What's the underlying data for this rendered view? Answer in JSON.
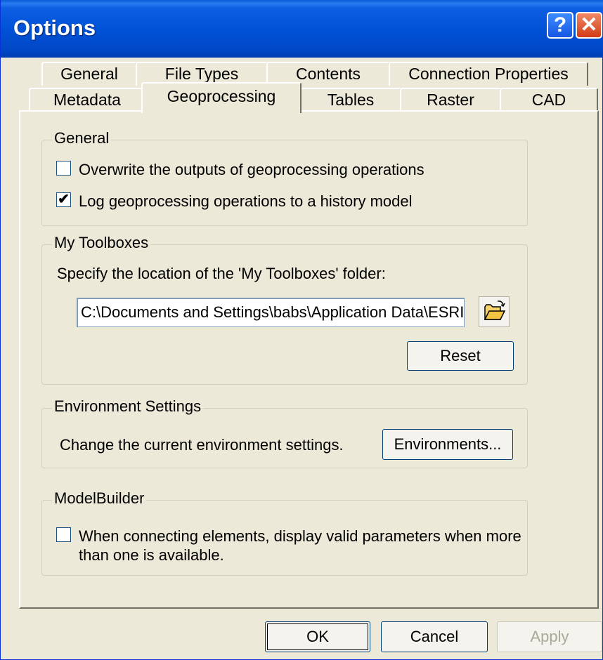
{
  "window": {
    "title": "Options",
    "help_glyph": "?",
    "close_glyph": "✕"
  },
  "tabs": {
    "row1": [
      "General",
      "File Types",
      "Contents",
      "Connection Properties"
    ],
    "row2": [
      "Metadata",
      "Geoprocessing",
      "Tables",
      "Raster",
      "CAD"
    ],
    "active": "Geoprocessing"
  },
  "general_group": {
    "title": "General",
    "overwrite": {
      "label": "Overwrite the outputs of geoprocessing operations",
      "checked": false
    },
    "log_history": {
      "label": "Log geoprocessing operations to a history model",
      "checked": true
    }
  },
  "toolboxes_group": {
    "title": "My Toolboxes",
    "instruction": "Specify the location of the 'My Toolboxes' folder:",
    "path": "C:\\Documents and Settings\\babs\\Application Data\\ESRI",
    "browse_icon": "open-folder-icon",
    "reset_label": "Reset"
  },
  "environment_group": {
    "title": "Environment Settings",
    "description": "Change the current environment settings.",
    "button_label": "Environments..."
  },
  "modelbuilder_group": {
    "title": "ModelBuilder",
    "display_valid": {
      "label_line1": "When connecting elements, display valid parameters when more",
      "label_line2": "than one is available.",
      "checked": false
    }
  },
  "footer": {
    "ok_label": "OK",
    "cancel_label": "Cancel",
    "apply_label": "Apply"
  }
}
